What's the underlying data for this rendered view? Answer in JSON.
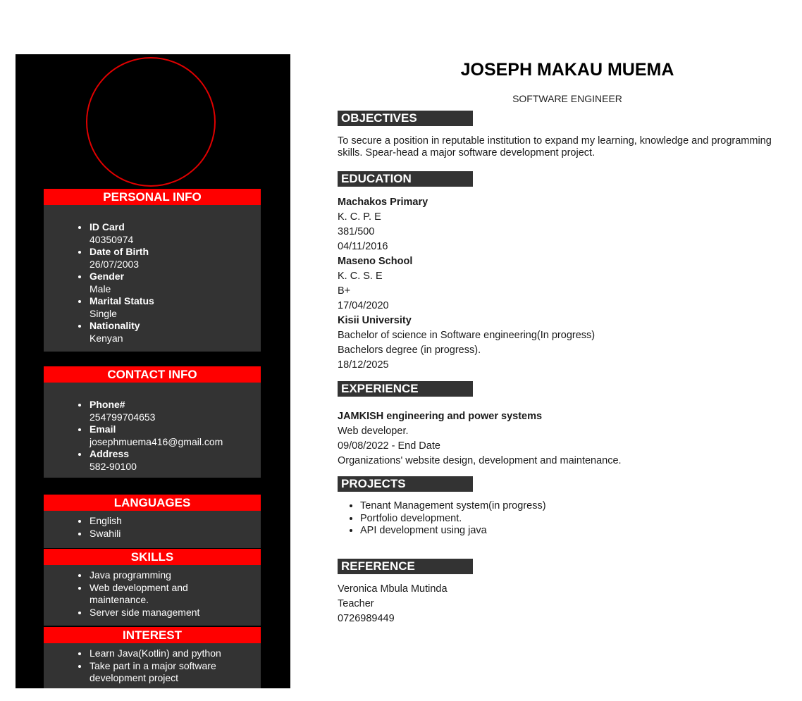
{
  "header": {
    "name": "JOSEPH MAKAU MUEMA",
    "title": "SOFTWARE ENGINEER"
  },
  "sidebar": {
    "personal": {
      "heading": "PERSONAL INFO",
      "items": [
        {
          "label": "ID Card",
          "value": "40350974"
        },
        {
          "label": "Date of Birth",
          "value": "26/07/2003"
        },
        {
          "label": "Gender",
          "value": "Male"
        },
        {
          "label": "Marital Status",
          "value": "Single"
        },
        {
          "label": "Nationality",
          "value": "Kenyan"
        }
      ]
    },
    "contact": {
      "heading": "CONTACT INFO",
      "items": [
        {
          "label": "Phone#",
          "value": "254799704653"
        },
        {
          "label": "Email",
          "value": "josephmuema416@gmail.com"
        },
        {
          "label": "Address",
          "value": "582-90100"
        }
      ]
    },
    "languages": {
      "heading": "LANGUAGES",
      "items": [
        "English",
        "Swahili"
      ]
    },
    "skills": {
      "heading": "SKILLS",
      "items": [
        "Java programming",
        "Web development and maintenance.",
        "Server side management"
      ]
    },
    "interest": {
      "heading": "INTEREST",
      "items": [
        "Learn Java(Kotlin) and python",
        "Take part in a major software development project"
      ]
    }
  },
  "main": {
    "objectives": {
      "heading": "OBJECTIVES",
      "text": "To secure a position in reputable institution to expand my learning, knowledge and programming skills. Spear-head a major software development project."
    },
    "education": {
      "heading": "EDUCATION",
      "entries": [
        {
          "school": "Machakos Primary",
          "lines": [
            "K. C. P. E",
            "381/500",
            "04/11/2016"
          ]
        },
        {
          "school": "Maseno School",
          "lines": [
            "K. C. S. E",
            "B+",
            "17/04/2020"
          ]
        },
        {
          "school": "Kisii University",
          "lines": [
            "Bachelor of science in Software engineering(In progress)",
            "Bachelors degree (in progress).",
            "18/12/2025"
          ]
        }
      ]
    },
    "experience": {
      "heading": "EXPERIENCE",
      "company": "JAMKISH engineering and power systems",
      "lines": [
        "Web developer.",
        "09/08/2022 - End Date",
        "Organizations' website design, development and maintenance."
      ]
    },
    "projects": {
      "heading": "PROJECTS",
      "items": [
        "Tenant Management system(in progress)",
        "Portfolio development.",
        "API development using java"
      ]
    },
    "reference": {
      "heading": "REFERENCE",
      "lines": [
        "Veronica Mbula Mutinda",
        "Teacher",
        "0726989449"
      ]
    }
  },
  "colors": {
    "accent_red": "#ff0000",
    "sidebar_bg": "#000000",
    "panel_bg": "#333333"
  }
}
